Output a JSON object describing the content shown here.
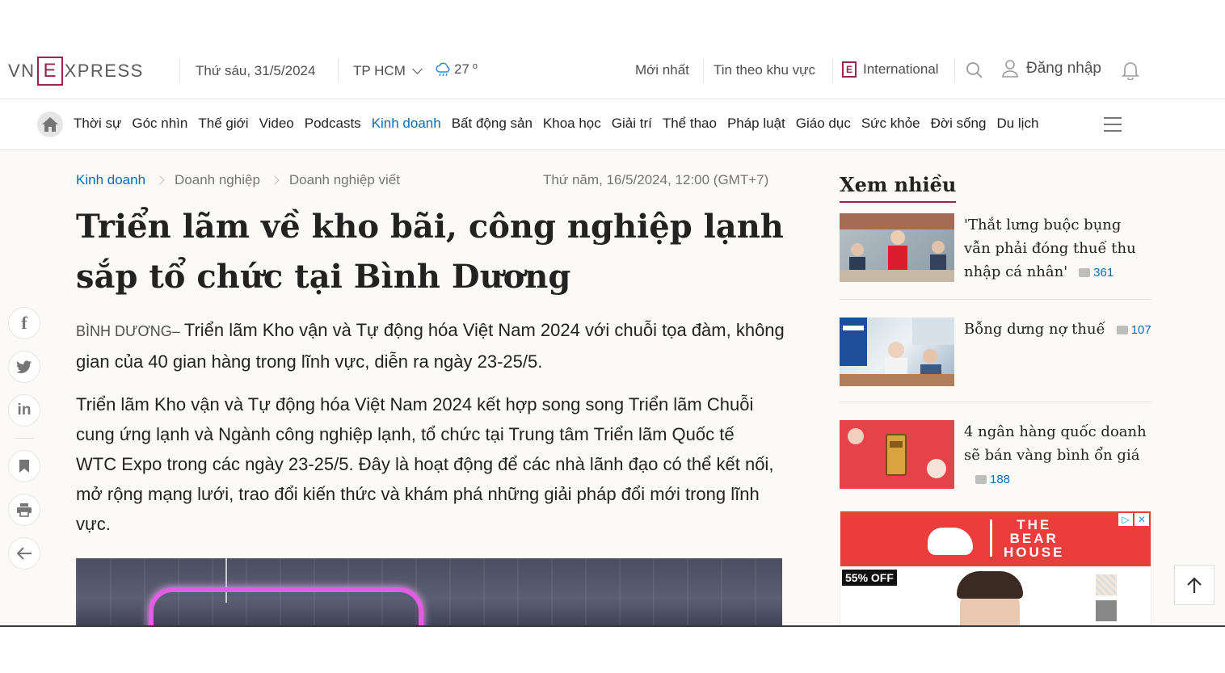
{
  "header": {
    "logo": {
      "left": "VN",
      "e": "E",
      "right": "XPRESS"
    },
    "date": "Thứ sáu, 31/5/2024",
    "city": "TP HCM",
    "temperature": "27",
    "temp_unit": "o",
    "links": {
      "latest": "Mới nhất",
      "regional": "Tin theo khu vực",
      "international": "International"
    },
    "login": "Đăng nhập",
    "icons": [
      "search-icon",
      "user-icon",
      "bell-icon",
      "weather-icon"
    ]
  },
  "nav": {
    "items": [
      {
        "label": "Thời sự"
      },
      {
        "label": "Góc nhìn"
      },
      {
        "label": "Thế giới"
      },
      {
        "label": "Video"
      },
      {
        "label": "Podcasts"
      },
      {
        "label": "Kinh doanh",
        "active": true
      },
      {
        "label": "Bất động sản"
      },
      {
        "label": "Khoa học"
      },
      {
        "label": "Giải trí"
      },
      {
        "label": "Thể thao"
      },
      {
        "label": "Pháp luật"
      },
      {
        "label": "Giáo dục"
      },
      {
        "label": "Sức khỏe"
      },
      {
        "label": "Đời sống"
      },
      {
        "label": "Du lịch"
      }
    ],
    "active_color": "#076db6"
  },
  "breadcrumb": [
    "Kinh doanh",
    "Doanh nghiệp",
    "Doanh nghiệp viết"
  ],
  "article": {
    "published": "Thứ năm, 16/5/2024, 12:00 (GMT+7)",
    "title": "Triển lãm về kho bãi, công nghiệp lạnh sắp tổ chức tại Bình Dương",
    "location": "BÌNH DƯƠNG– ",
    "lead": "Triển lãm Kho vận và Tự động hóa Việt Nam 2024 với chuỗi tọa đàm, không gian của 40 gian hàng trong lĩnh vực, diễn ra ngày 23-25/5.",
    "paragraph": "Triển lãm Kho vận và Tự động hóa Việt Nam 2024 kết hợp song song Triển lãm Chuỗi cung ứng lạnh và Ngành công nghiệp lạnh, tổ chức tại Trung tâm Triển lãm Quốc tế WTC Expo trong các ngày 23-25/5. Đây là hoạt động để các nhà lãnh đạo có thể kết nối, mở rộng mạng lưới, trao đổi kiến thức và khám phá những giải pháp đổi mới trong lĩnh vực."
  },
  "social": {
    "facebook": "f",
    "linkedin": "in",
    "icons": [
      "facebook-icon",
      "twitter-icon",
      "linkedin-icon",
      "bookmark-icon",
      "print-icon",
      "back-arrow-icon"
    ]
  },
  "sidebar": {
    "title": "Xem nhiều",
    "items": [
      {
        "title": "'Thắt lưng buộc bụng vẫn phải đóng thuế thu nhập cá nhân'",
        "comments": "361"
      },
      {
        "title": "Bỗng dưng nợ thuế",
        "comments": "107"
      },
      {
        "title": "4 ngân hàng quốc doanh sẽ bán vàng bình ổn giá",
        "comments": "188"
      }
    ]
  },
  "ad": {
    "brand_line1": "THE",
    "brand_line2": "BEAR",
    "brand_line3": "HOUSE",
    "discount": "55% OFF",
    "choices_icon": "▷",
    "close_icon": "✕",
    "accent": "#ec3d3d"
  },
  "colors": {
    "brand": "#9f224e",
    "link": "#076db6",
    "background": "#fcfaf6"
  }
}
